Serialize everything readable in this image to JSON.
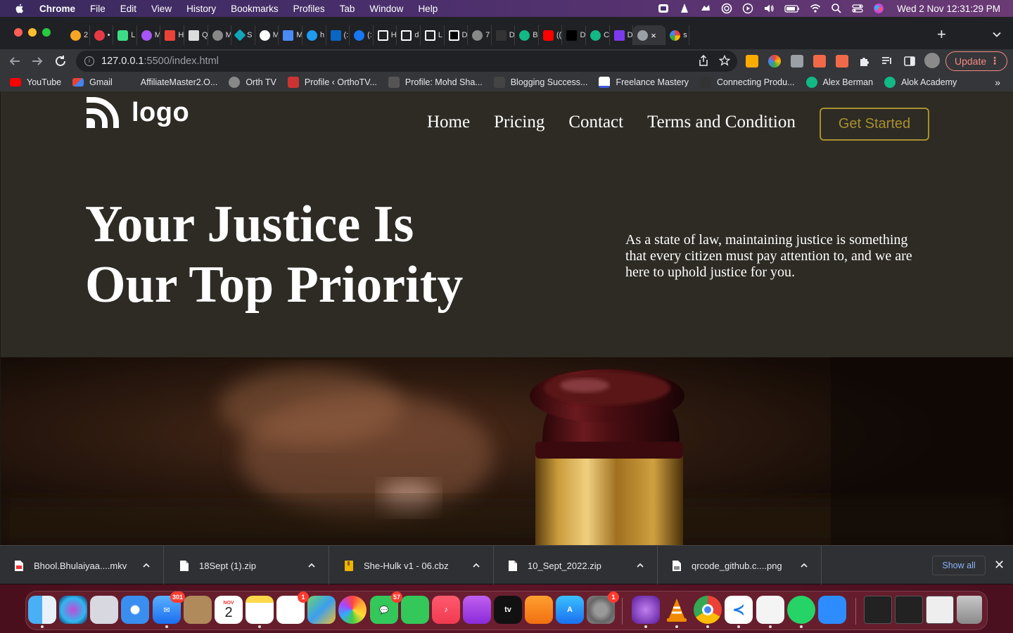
{
  "menubar": {
    "app_name": "Chrome",
    "items": [
      "File",
      "Edit",
      "View",
      "History",
      "Bookmarks",
      "Profiles",
      "Tab",
      "Window",
      "Help"
    ],
    "clock": "Wed 2 Nov  12:31:29 PM"
  },
  "tabs": [
    {
      "label": "2",
      "color": "#f5a623"
    },
    {
      "label": "•",
      "color": "#e63946"
    },
    {
      "label": "L",
      "color": "#3ddc84"
    },
    {
      "label": "M",
      "color": "#a855f7"
    },
    {
      "label": "H",
      "color": "#ea4335"
    },
    {
      "label": "Q",
      "color": "#dddddd"
    },
    {
      "label": "M",
      "color": "#888888"
    },
    {
      "label": "S",
      "color": "#12a4b8"
    },
    {
      "label": "M",
      "color": "#ffffff"
    },
    {
      "label": "M",
      "color": "#4a8af4"
    },
    {
      "label": "h",
      "color": "#1d9bf0"
    },
    {
      "label": "(:",
      "color": "#0a66c2"
    },
    {
      "label": "(:",
      "color": "#1877f2"
    },
    {
      "label": "H",
      "color": "#ffffff"
    },
    {
      "label": "d",
      "color": "#ffffff"
    },
    {
      "label": "L",
      "color": "#ffffff"
    },
    {
      "label": "D",
      "color": "#000000"
    },
    {
      "label": "7",
      "color": "#888888"
    },
    {
      "label": "D",
      "color": "#333333"
    },
    {
      "label": "B",
      "color": "#12b886"
    },
    {
      "label": "((",
      "color": "#ff0000"
    },
    {
      "label": "D",
      "color": "#000000"
    },
    {
      "label": "C",
      "color": "#12b886"
    },
    {
      "label": "D",
      "color": "#7c3aed"
    }
  ],
  "active_tab": {
    "label": "×"
  },
  "last_tab": {
    "label": "s"
  },
  "toolbar": {
    "url_host": "127.0.0.1",
    "url_path": ":5500/index.html",
    "update_label": "Update"
  },
  "bookmarks": [
    {
      "label": "YouTube",
      "color": "#ff0000"
    },
    {
      "label": "Gmail",
      "color": "#ea4335"
    },
    {
      "label": "AffiliateMaster2.O...",
      "color": "#35363a"
    },
    {
      "label": "Orth TV",
      "color": "#888888"
    },
    {
      "label": "Profile ‹ OrthoTV...",
      "color": "#cc3333"
    },
    {
      "label": "Profile: Mohd Sha...",
      "color": "#555555"
    },
    {
      "label": "Blogging Success...",
      "color": "#444444"
    },
    {
      "label": "Freelance Mastery",
      "color": "#3b5bdb"
    },
    {
      "label": "Connecting Produ...",
      "color": "#333333"
    },
    {
      "label": "Alex Berman",
      "color": "#12b886"
    },
    {
      "label": "Alok Academy",
      "color": "#12b886"
    }
  ],
  "site": {
    "logo_text": "logo",
    "nav": [
      "Home",
      "Pricing",
      "Contact",
      "Terms and Condition"
    ],
    "cta_label": "Get Started",
    "hero_title_line1": "Your Justice Is",
    "hero_title_line2": "Our Top Priority",
    "hero_text": "As a state of law, maintaining justice is something that every citizen must pay attention to, and we are here to uphold justice for you.",
    "accent_color": "#a89030",
    "background_color": "#2d2b24"
  },
  "downloads": {
    "items": [
      {
        "name": "Bhool.Bhulaiyaa....mkv"
      },
      {
        "name": "18Sept (1).zip"
      },
      {
        "name": "She-Hulk v1 - 06.cbz"
      },
      {
        "name": "10_Sept_2022.zip"
      },
      {
        "name": "qrcode_github.c....png"
      }
    ],
    "show_all_label": "Show all"
  },
  "dock": {
    "mail_badge": "301",
    "calendar_month": "NOV",
    "calendar_day": "2",
    "reminders_badge": "1",
    "messages_badge": "57",
    "settings_badge": "1",
    "tv_label": "tv"
  }
}
